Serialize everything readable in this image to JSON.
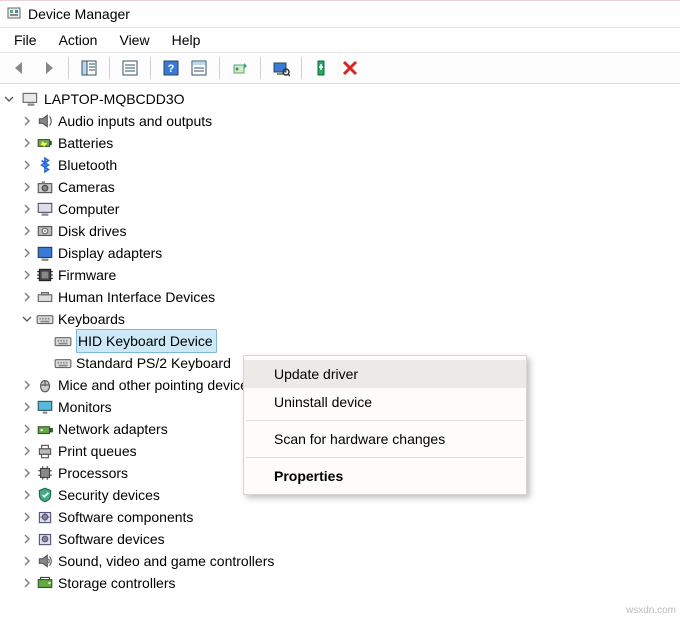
{
  "window": {
    "title": "Device Manager"
  },
  "menu": {
    "file": "File",
    "action": "Action",
    "view": "View",
    "help": "Help"
  },
  "tree": {
    "root": "LAPTOP-MQBCDD3O",
    "items": [
      {
        "label": "Audio inputs and outputs"
      },
      {
        "label": "Batteries"
      },
      {
        "label": "Bluetooth"
      },
      {
        "label": "Cameras"
      },
      {
        "label": "Computer"
      },
      {
        "label": "Disk drives"
      },
      {
        "label": "Display adapters"
      },
      {
        "label": "Firmware"
      },
      {
        "label": "Human Interface Devices"
      },
      {
        "label": "Keyboards",
        "expanded": true,
        "children": [
          {
            "label": "HID Keyboard Device",
            "selected": true
          },
          {
            "label": "Standard PS/2 Keyboard"
          }
        ]
      },
      {
        "label": "Mice and other pointing devices"
      },
      {
        "label": "Monitors"
      },
      {
        "label": "Network adapters"
      },
      {
        "label": "Print queues"
      },
      {
        "label": "Processors"
      },
      {
        "label": "Security devices"
      },
      {
        "label": "Software components"
      },
      {
        "label": "Software devices"
      },
      {
        "label": "Sound, video and game controllers"
      },
      {
        "label": "Storage controllers"
      }
    ]
  },
  "context_menu": {
    "update": "Update driver",
    "uninstall": "Uninstall device",
    "scan": "Scan for hardware changes",
    "properties": "Properties"
  },
  "watermark": "wsxdn.com"
}
